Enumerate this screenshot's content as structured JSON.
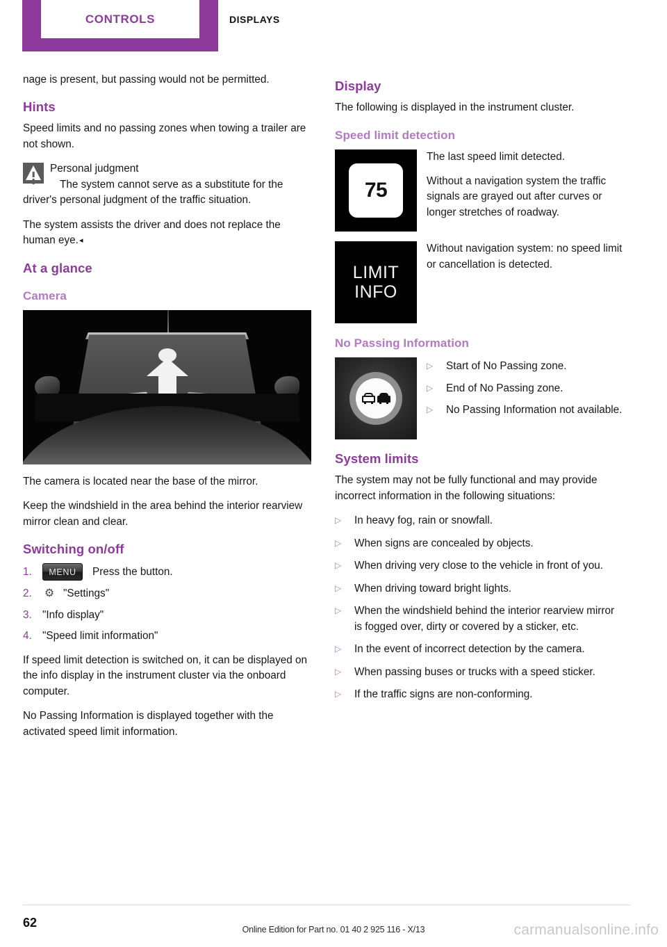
{
  "header": {
    "active_tab": "CONTROLS",
    "inactive_tab": "DISPLAYS"
  },
  "left_column": {
    "continued_paragraph": "nage is present, but passing would not be permitted.",
    "hints_heading": "Hints",
    "hints_paragraph": "Speed limits and no passing zones when towing a trailer are not shown.",
    "warning": {
      "icon": "warning-triangle-icon",
      "title": "Personal judgment",
      "body": "The system cannot serve as a substitute for the driver's personal judgment of the traffic situation.",
      "closing": "The system assists the driver and does not replace the human eye.",
      "end_marker": "◂"
    },
    "at_a_glance_heading": "At a glance",
    "camera_heading": "Camera",
    "camera_photo_alt": "Front windshield of vehicle with camera location arrow",
    "camera_paragraph_1": "The camera is located near the base of the mirror.",
    "camera_paragraph_2": "Keep the windshield in the area behind the interior rearview mirror clean and clear.",
    "switching_heading": "Switching on/off",
    "steps": [
      {
        "number": "1.",
        "icon": "menu-button-icon",
        "icon_label": "MENU",
        "text": "Press the button."
      },
      {
        "number": "2.",
        "icon": "gear-icon",
        "icon_label": "⚙",
        "text": "\"Settings\""
      },
      {
        "number": "3.",
        "icon": null,
        "icon_label": null,
        "text": "\"Info display\""
      },
      {
        "number": "4.",
        "icon": null,
        "icon_label": null,
        "text": "\"Speed limit information\""
      }
    ],
    "closing_paragraph_1": "If speed limit detection is switched on, it can be displayed on the info display in the instrument cluster via the onboard computer.",
    "closing_paragraph_2": "No Passing Information is displayed together with the activated speed limit information."
  },
  "right_column": {
    "display_heading": "Display",
    "display_paragraph": "The following is displayed in the instrument cluster.",
    "speed_limit_heading": "Speed limit detection",
    "speed_sign": {
      "icon": "speed-limit-sign-icon",
      "value": "75",
      "paragraph_1": "The last speed limit detected.",
      "paragraph_2": "Without a navigation system the traffic signals are grayed out after curves or longer stretches of roadway."
    },
    "limit_info_sign": {
      "icon": "limit-info-sign-icon",
      "line_1": "LIMIT",
      "line_2": "INFO",
      "paragraph": "Without navigation system: no speed limit or cancellation is detected."
    },
    "no_passing_heading": "No Passing Information",
    "no_passing_sign": {
      "icon": "no-passing-sign-icon"
    },
    "no_passing_items": [
      "Start of No Passing zone.",
      "End of No Passing zone.",
      "No Passing Information not available."
    ],
    "system_limits_heading": "System limits",
    "system_limits_paragraph": "The system may not be fully functional and may provide incorrect information in the following situations:",
    "system_limits_items": [
      "In heavy fog, rain or snowfall.",
      "When signs are concealed by objects.",
      "When driving very close to the vehicle in front of you.",
      "When driving toward bright lights.",
      "When the windshield behind the interior rearview mirror is fogged over, dirty or covered by a sticker, etc.",
      "In the event of incorrect detection by the camera.",
      "When passing buses or trucks with a speed sticker.",
      "If the traffic signs are non-conforming."
    ],
    "bullet_glyph": "▷"
  },
  "footer": {
    "page_number": "62",
    "edition": "Online Edition for Part no. 01 40 2 925 116 - X/13",
    "watermark": "carmanualsonline.info"
  },
  "colors": {
    "brand_purple": "#8e3a9d",
    "light_purple": "#b479c4"
  }
}
